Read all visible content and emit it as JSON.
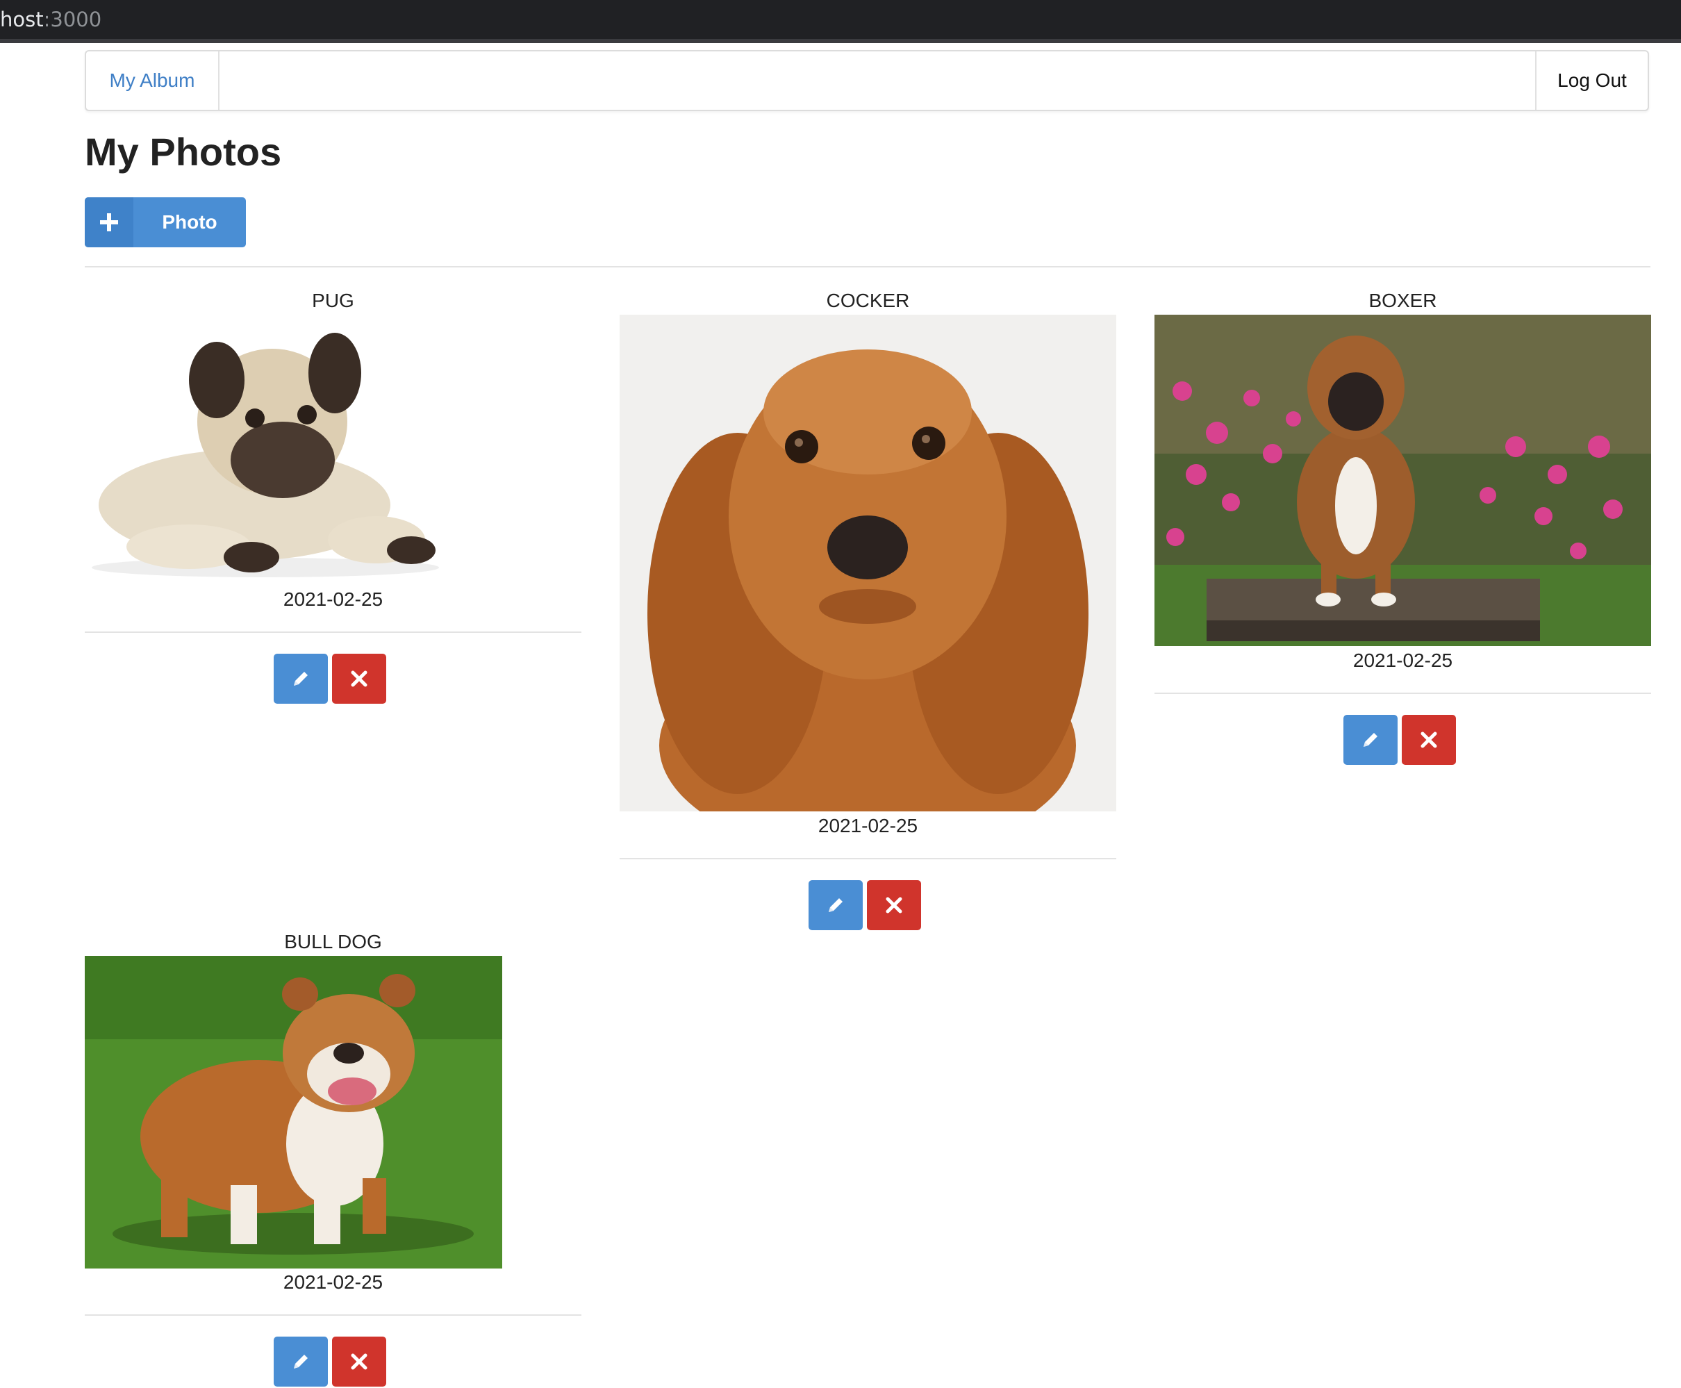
{
  "browser": {
    "url_host": "host",
    "url_port": ":3000"
  },
  "navbar": {
    "brand": "My Album",
    "logout": "Log Out"
  },
  "page": {
    "title": "My Photos",
    "add_button_label": "Photo"
  },
  "photos": [
    {
      "title": "PUG",
      "date": "2021-02-25"
    },
    {
      "title": "COCKER",
      "date": "2021-02-25"
    },
    {
      "title": "BOXER",
      "date": "2021-02-25"
    },
    {
      "title": "BULL DOG",
      "date": "2021-02-25"
    }
  ],
  "icons": {
    "add": "plus-icon",
    "edit": "pencil-icon",
    "delete": "close-icon"
  },
  "colors": {
    "primary": "#4a8ed4",
    "danger": "#d0342c",
    "link": "#3f7fc6"
  }
}
